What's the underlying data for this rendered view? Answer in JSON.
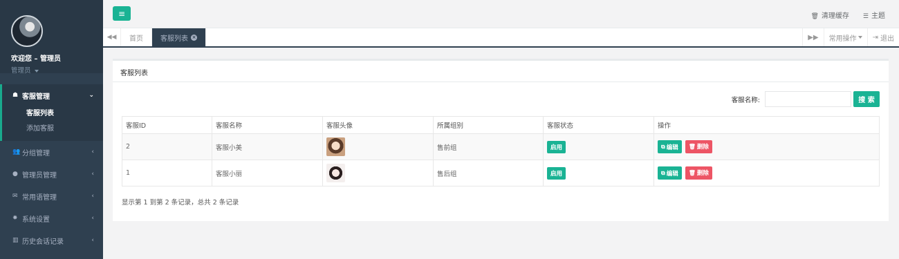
{
  "sidebar": {
    "welcome": "欢迎您 – 管理员",
    "role": "管理员",
    "groups": [
      {
        "label": "客服管理",
        "icon": "qq-icon",
        "glyph": "☗",
        "arrow": "⌄",
        "children": [
          "客服列表",
          "添加客服"
        ]
      },
      {
        "label": "分组管理",
        "icon": "users-icon",
        "glyph": "👥",
        "arrow": "‹"
      },
      {
        "label": "管理员管理",
        "icon": "user-icon",
        "glyph": "●",
        "arrow": "‹"
      },
      {
        "label": "常用语管理",
        "icon": "comments-icon",
        "glyph": "✉",
        "arrow": "‹"
      },
      {
        "label": "系统设置",
        "icon": "gear-icon",
        "glyph": "✸",
        "arrow": "‹"
      },
      {
        "label": "历史会话记录",
        "icon": "bar-chart-icon",
        "glyph": "▥",
        "arrow": "‹"
      }
    ]
  },
  "topbar": {
    "menu_glyph": "≡",
    "clear_cache": "清理缓存",
    "clear_cache_icon": "🗑",
    "theme": "主题",
    "theme_icon": "☰"
  },
  "tabs": {
    "prev": "◀◀",
    "items": [
      {
        "label": "首页"
      },
      {
        "label": "客服列表",
        "close": "×"
      }
    ],
    "next": "▶▶",
    "ops": "常用操作",
    "logout": "退出",
    "logout_icon": "⇥"
  },
  "panel": {
    "title": "客服列表",
    "search_label": "客服名称:",
    "search_value": "",
    "search_button": "搜 索",
    "columns": [
      "客服ID",
      "客服名称",
      "客服头像",
      "所属组别",
      "客服状态",
      "操作"
    ],
    "rows": [
      {
        "id": "2",
        "name": "客服小美",
        "group": "售前组",
        "status": "启用"
      },
      {
        "id": "1",
        "name": "客服小丽",
        "group": "售后组",
        "status": "启用"
      }
    ],
    "edit_label": "编辑",
    "delete_label": "删除",
    "summary": "显示第 1 到第 2 条记录，总共 2 条记录"
  },
  "colors": {
    "accent": "#1ab394",
    "danger": "#ed5565",
    "sidebar": "#2f4050"
  }
}
